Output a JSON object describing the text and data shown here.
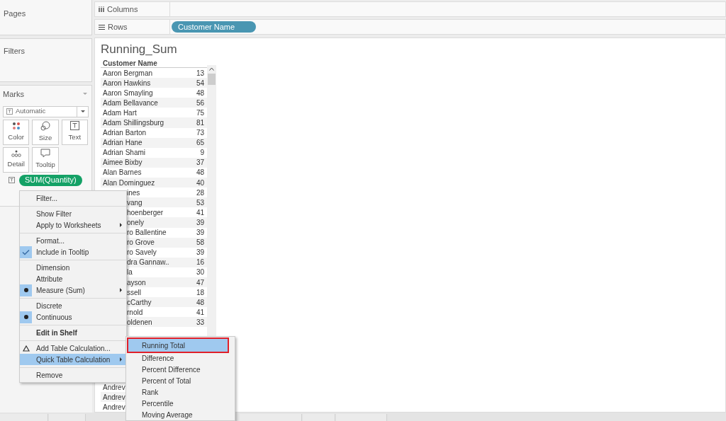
{
  "pages": {
    "title": "Pages"
  },
  "filters": {
    "title": "Filters"
  },
  "marks": {
    "title": "Marks",
    "mark_type": "Automatic",
    "cards": [
      {
        "label": "Color",
        "kind": "color"
      },
      {
        "label": "Size",
        "kind": "size"
      },
      {
        "label": "Text",
        "kind": "text"
      },
      {
        "label": "Detail",
        "kind": "detail"
      },
      {
        "label": "Tooltip",
        "kind": "tooltip"
      }
    ],
    "pill": "SUM(Quantity)"
  },
  "columns_shelf": {
    "label": "Columns"
  },
  "rows_shelf": {
    "label": "Rows",
    "pills": [
      "Customer Name"
    ]
  },
  "view": {
    "title": "Running_Sum",
    "header": "Customer Name",
    "rows": [
      {
        "name": "Aaron Bergman",
        "value": "13",
        "partial": false
      },
      {
        "name": "Aaron Hawkins",
        "value": "54",
        "partial": false
      },
      {
        "name": "Aaron Smayling",
        "value": "48",
        "partial": false
      },
      {
        "name": "Adam Bellavance",
        "value": "56",
        "partial": false
      },
      {
        "name": "Adam Hart",
        "value": "75",
        "partial": false
      },
      {
        "name": "Adam Shillingsburg",
        "value": "81",
        "partial": false
      },
      {
        "name": "Adrian Barton",
        "value": "73",
        "partial": false
      },
      {
        "name": "Adrian Hane",
        "value": "65",
        "partial": false
      },
      {
        "name": "Adrian Shami",
        "value": "9",
        "partial": false
      },
      {
        "name": "Aimee Bixby",
        "value": "37",
        "partial": false
      },
      {
        "name": "Alan Barnes",
        "value": "48",
        "partial": false
      },
      {
        "name": "Alan Dominguez",
        "value": "40",
        "partial": false
      },
      {
        "name": "ines",
        "value": "28",
        "partial": true
      },
      {
        "name": "vang",
        "value": "53",
        "partial": true
      },
      {
        "name": "hoenberger",
        "value": "41",
        "partial": true
      },
      {
        "name": "onely",
        "value": "39",
        "partial": true
      },
      {
        "name": "ro Ballentine",
        "value": "39",
        "partial": true
      },
      {
        "name": "ro Grove",
        "value": "58",
        "partial": true
      },
      {
        "name": "ro Savely",
        "value": "39",
        "partial": true
      },
      {
        "name": "dra Gannaw..",
        "value": "16",
        "partial": true
      },
      {
        "name": "la",
        "value": "30",
        "partial": true
      },
      {
        "name": "ayson",
        "value": "47",
        "partial": true
      },
      {
        "name": "ssell",
        "value": "18",
        "partial": true
      },
      {
        "name": "cCarthy",
        "value": "48",
        "partial": true
      },
      {
        "name": "rnold",
        "value": "41",
        "partial": true
      },
      {
        "name": "oldenen",
        "value": "33",
        "partial": true
      }
    ],
    "bottom_rows": [
      "Andrev",
      "Andrev",
      "Andrev"
    ]
  },
  "context_menu": {
    "groups": [
      [
        {
          "label": "Filter...",
          "kind": "plain",
          "checked": false,
          "selected": false,
          "has_submenu": false,
          "bold": false
        }
      ],
      [
        {
          "label": "Show Filter",
          "kind": "plain",
          "checked": false,
          "selected": false,
          "has_submenu": false,
          "bold": false
        },
        {
          "label": "Apply to Worksheets",
          "kind": "plain",
          "checked": false,
          "selected": false,
          "has_submenu": true,
          "bold": false
        }
      ],
      [
        {
          "label": "Format...",
          "kind": "plain",
          "checked": false,
          "selected": false,
          "has_submenu": false,
          "bold": false
        },
        {
          "label": "Include in Tooltip",
          "kind": "check",
          "checked": true,
          "selected": false,
          "has_submenu": false,
          "bold": false
        }
      ],
      [
        {
          "label": "Dimension",
          "kind": "radio",
          "checked": false,
          "selected": false,
          "has_submenu": false,
          "bold": false
        },
        {
          "label": "Attribute",
          "kind": "radio",
          "checked": false,
          "selected": false,
          "has_submenu": false,
          "bold": false
        },
        {
          "label": "Measure (Sum)",
          "kind": "radio",
          "checked": true,
          "selected": false,
          "has_submenu": true,
          "bold": false
        }
      ],
      [
        {
          "label": "Discrete",
          "kind": "radio",
          "checked": false,
          "selected": false,
          "has_submenu": false,
          "bold": false
        },
        {
          "label": "Continuous",
          "kind": "radio",
          "checked": true,
          "selected": false,
          "has_submenu": false,
          "bold": false
        }
      ],
      [
        {
          "label": "Edit in Shelf",
          "kind": "plain",
          "checked": false,
          "selected": false,
          "has_submenu": false,
          "bold": true
        }
      ],
      [
        {
          "label": "Add Table Calculation...",
          "kind": "calc",
          "checked": false,
          "selected": false,
          "has_submenu": false,
          "bold": false
        },
        {
          "label": "Quick Table Calculation",
          "kind": "plain",
          "checked": false,
          "selected": true,
          "has_submenu": true,
          "bold": false
        }
      ],
      [
        {
          "label": "Remove",
          "kind": "plain",
          "checked": false,
          "selected": false,
          "has_submenu": false,
          "bold": false
        }
      ]
    ]
  },
  "submenu": {
    "items": [
      {
        "label": "Running Total",
        "selected": true,
        "outlined": true
      },
      {
        "label": "Difference",
        "selected": false,
        "outlined": false
      },
      {
        "label": "Percent Difference",
        "selected": false,
        "outlined": false
      },
      {
        "label": "Percent of Total",
        "selected": false,
        "outlined": false
      },
      {
        "label": "Rank",
        "selected": false,
        "outlined": false
      },
      {
        "label": "Percentile",
        "selected": false,
        "outlined": false
      },
      {
        "label": "Moving Average",
        "selected": false,
        "outlined": false
      }
    ]
  }
}
